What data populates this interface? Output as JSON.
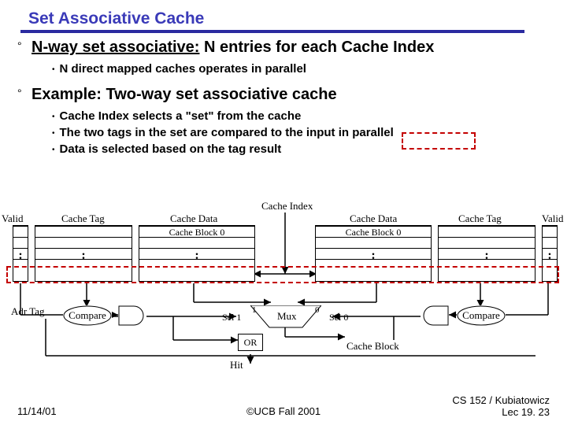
{
  "title": "Set Associative Cache",
  "p1_prefix": "N-way set associative:",
  "p1_rest": " N entries for each Cache Index",
  "b1": "N direct mapped caches operates in parallel",
  "p2": "Example: Two-way set associative cache",
  "b2": "Cache Index selects a \"set\" from the cache",
  "b3": "The two tags in the set are compared to the input in parallel",
  "b4": "Data is selected based on the tag result",
  "diagram": {
    "cache_index": "Cache Index",
    "valid": "Valid",
    "cache_tag": "Cache Tag",
    "cache_data": "Cache Data",
    "cache_block0": "Cache Block 0",
    "adr_tag": "Adr Tag",
    "compare": "Compare",
    "sel1": "Sel 1",
    "sel0": "Sel 0",
    "mux": "Mux",
    "one": "1",
    "zero": "0",
    "or": "OR",
    "hit": "Hit",
    "cache_block": "Cache Block",
    "dots": ":"
  },
  "footer": {
    "date": "11/14/01",
    "center": "©UCB Fall 2001",
    "right1": "CS 152 / Kubiatowicz",
    "right2": "Lec 19. 23"
  }
}
